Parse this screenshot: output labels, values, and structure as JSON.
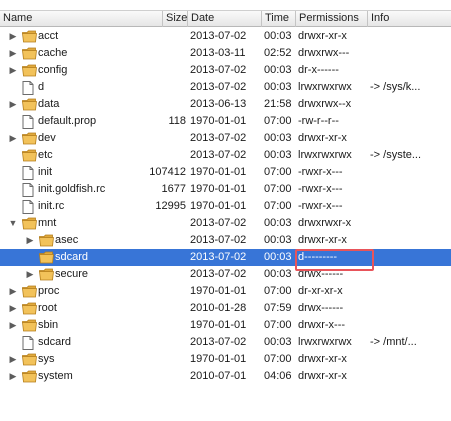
{
  "columns": {
    "name": "Name",
    "size": "Size",
    "date": "Date",
    "time": "Time",
    "permissions": "Permissions",
    "info": "Info"
  },
  "colors": {
    "selection": "#3875d7",
    "highlight_box": "#e8545a",
    "folder": "#f2c25a"
  },
  "rows": [
    {
      "name": "acct",
      "type": "folder",
      "expander": "collapsed",
      "level": 0,
      "size": "",
      "date": "2013-07-02",
      "time": "00:03",
      "permissions": "drwxr-xr-x",
      "info": ""
    },
    {
      "name": "cache",
      "type": "folder",
      "expander": "collapsed",
      "level": 0,
      "size": "",
      "date": "2013-03-11",
      "time": "02:52",
      "permissions": "drwxrwx---",
      "info": ""
    },
    {
      "name": "config",
      "type": "folder",
      "expander": "collapsed",
      "level": 0,
      "size": "",
      "date": "2013-07-02",
      "time": "00:03",
      "permissions": "dr-x------",
      "info": ""
    },
    {
      "name": "d",
      "type": "file",
      "expander": "none",
      "level": 0,
      "size": "",
      "date": "2013-07-02",
      "time": "00:03",
      "permissions": "lrwxrwxrwx",
      "info": "-> /sys/k..."
    },
    {
      "name": "data",
      "type": "folder",
      "expander": "collapsed",
      "level": 0,
      "size": "",
      "date": "2013-06-13",
      "time": "21:58",
      "permissions": "drwxrwx--x",
      "info": ""
    },
    {
      "name": "default.prop",
      "type": "file",
      "expander": "none",
      "level": 0,
      "size": "118",
      "date": "1970-01-01",
      "time": "07:00",
      "permissions": "-rw-r--r--",
      "info": ""
    },
    {
      "name": "dev",
      "type": "folder",
      "expander": "collapsed",
      "level": 0,
      "size": "",
      "date": "2013-07-02",
      "time": "00:03",
      "permissions": "drwxr-xr-x",
      "info": ""
    },
    {
      "name": "etc",
      "type": "folder",
      "expander": "none",
      "level": 0,
      "size": "",
      "date": "2013-07-02",
      "time": "00:03",
      "permissions": "lrwxrwxrwx",
      "info": "-> /syste..."
    },
    {
      "name": "init",
      "type": "file",
      "expander": "none",
      "level": 0,
      "size": "107412",
      "date": "1970-01-01",
      "time": "07:00",
      "permissions": "-rwxr-x---",
      "info": ""
    },
    {
      "name": "init.goldfish.rc",
      "type": "file",
      "expander": "none",
      "level": 0,
      "size": "1677",
      "date": "1970-01-01",
      "time": "07:00",
      "permissions": "-rwxr-x---",
      "info": ""
    },
    {
      "name": "init.rc",
      "type": "file",
      "expander": "none",
      "level": 0,
      "size": "12995",
      "date": "1970-01-01",
      "time": "07:00",
      "permissions": "-rwxr-x---",
      "info": ""
    },
    {
      "name": "mnt",
      "type": "folder",
      "expander": "expanded",
      "level": 0,
      "size": "",
      "date": "2013-07-02",
      "time": "00:03",
      "permissions": "drwxrwxr-x",
      "info": ""
    },
    {
      "name": "asec",
      "type": "folder",
      "expander": "collapsed",
      "level": 1,
      "size": "",
      "date": "2013-07-02",
      "time": "00:03",
      "permissions": "drwxr-xr-x",
      "info": ""
    },
    {
      "name": "sdcard",
      "type": "folder",
      "expander": "none",
      "level": 1,
      "size": "",
      "date": "2013-07-02",
      "time": "00:03",
      "permissions": "d---------",
      "info": "",
      "selected": true
    },
    {
      "name": "secure",
      "type": "folder",
      "expander": "collapsed",
      "level": 1,
      "size": "",
      "date": "2013-07-02",
      "time": "00:03",
      "permissions": "drwx------",
      "info": ""
    },
    {
      "name": "proc",
      "type": "folder",
      "expander": "collapsed",
      "level": 0,
      "size": "",
      "date": "1970-01-01",
      "time": "07:00",
      "permissions": "dr-xr-xr-x",
      "info": ""
    },
    {
      "name": "root",
      "type": "folder",
      "expander": "collapsed",
      "level": 0,
      "size": "",
      "date": "2010-01-28",
      "time": "07:59",
      "permissions": "drwx------",
      "info": ""
    },
    {
      "name": "sbin",
      "type": "folder",
      "expander": "collapsed",
      "level": 0,
      "size": "",
      "date": "1970-01-01",
      "time": "07:00",
      "permissions": "drwxr-x---",
      "info": ""
    },
    {
      "name": "sdcard",
      "type": "file",
      "expander": "none",
      "level": 0,
      "size": "",
      "date": "2013-07-02",
      "time": "00:03",
      "permissions": "lrwxrwxrwx",
      "info": "-> /mnt/..."
    },
    {
      "name": "sys",
      "type": "folder",
      "expander": "collapsed",
      "level": 0,
      "size": "",
      "date": "1970-01-01",
      "time": "07:00",
      "permissions": "drwxr-xr-x",
      "info": ""
    },
    {
      "name": "system",
      "type": "folder",
      "expander": "collapsed",
      "level": 0,
      "size": "",
      "date": "2010-07-01",
      "time": "04:06",
      "permissions": "drwxr-xr-x",
      "info": ""
    }
  ]
}
